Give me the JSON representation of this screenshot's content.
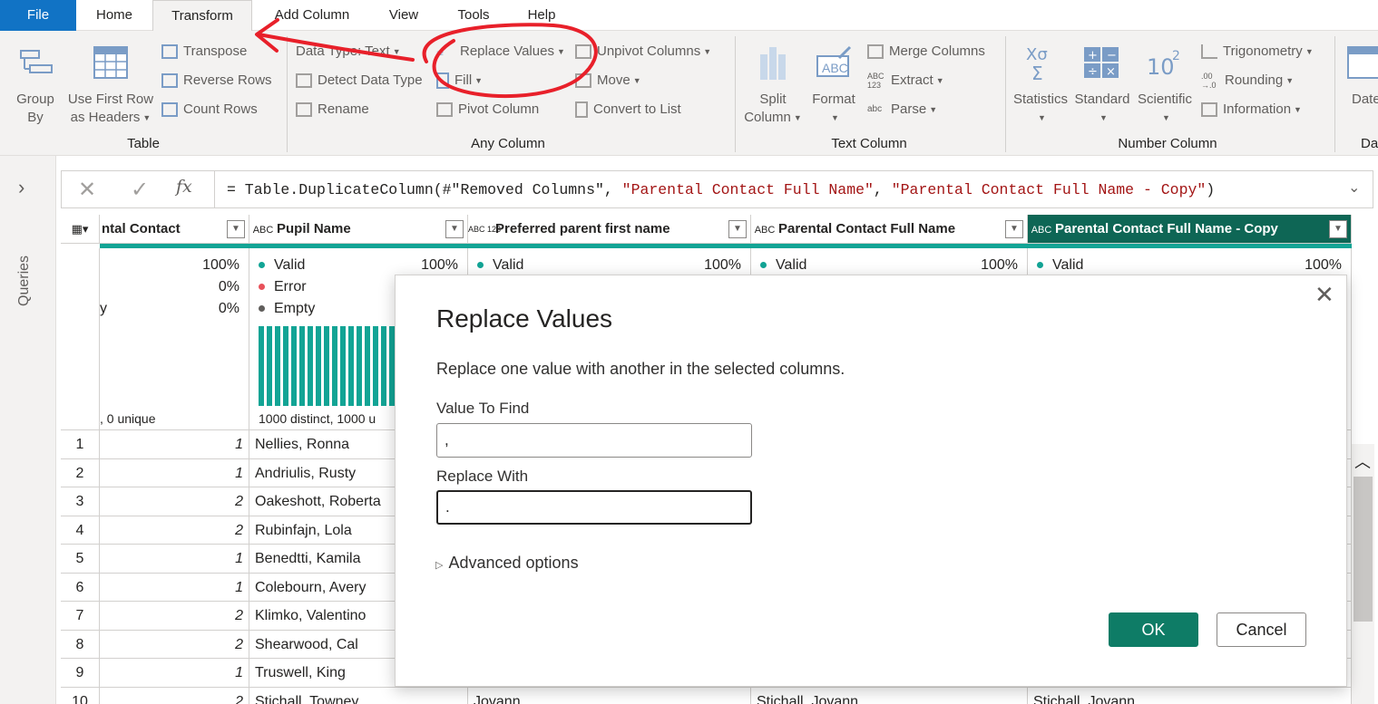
{
  "tabs": [
    "File",
    "Home",
    "Transform",
    "Add Column",
    "View",
    "Tools",
    "Help"
  ],
  "active_tab": "Transform",
  "ribbon": {
    "table": {
      "label": "Table",
      "group_by": [
        "Group",
        "By"
      ],
      "use_first_row": [
        "Use First Row",
        "as Headers"
      ],
      "transpose": "Transpose",
      "reverse_rows": "Reverse Rows",
      "count_rows": "Count Rows"
    },
    "any_column": {
      "label": "Any Column",
      "data_type": "Data Type: Text",
      "detect_data_type": "Detect Data Type",
      "rename": "Rename",
      "replace_values": "Replace Values",
      "fill": "Fill",
      "pivot_column": "Pivot Column",
      "unpivot_columns": "Unpivot Columns",
      "move": "Move",
      "convert_to_list": "Convert to List"
    },
    "text_column": {
      "label": "Text Column",
      "split_column": [
        "Split",
        "Column"
      ],
      "format": "Format",
      "merge_columns": "Merge Columns",
      "extract": "Extract",
      "parse": "Parse"
    },
    "number_column": {
      "label": "Number Column",
      "statistics": "Statistics",
      "standard": "Standard",
      "scientific": "Scientific",
      "trigonometry": "Trigonometry",
      "rounding": "Rounding",
      "information": "Information"
    },
    "date": {
      "label": "Da",
      "date": "Date"
    }
  },
  "queries_label": "Queries",
  "formula": {
    "prefix": "= Table.DuplicateColumn(#\"Removed Columns\", ",
    "arg1": "\"Parental Contact Full Name\"",
    "sep": ", ",
    "arg2": "\"Parental Contact Full Name - Copy\"",
    "suffix": ")"
  },
  "columns": [
    {
      "name": "ntal Contact",
      "type": ""
    },
    {
      "name": "Pupil Name",
      "type": "ABC"
    },
    {
      "name": "Preferred parent first name",
      "type": "ABC 123"
    },
    {
      "name": "Parental Contact Full Name",
      "type": "ABC"
    },
    {
      "name": "Parental Contact Full Name - Copy",
      "type": "ABC"
    }
  ],
  "profile": {
    "col0": {
      "p1": "100%",
      "p2": "0%",
      "p3": "0%",
      "p3label": "y",
      "footer": ", 0 unique"
    },
    "col1": {
      "valid": "Valid",
      "error": "Error",
      "empty": "Empty",
      "valid_pct": "100%",
      "footer": "1000 distinct, 1000 u"
    },
    "col2": {
      "valid": "Valid",
      "valid_pct": "100%"
    },
    "col3": {
      "valid": "Valid",
      "valid_pct": "100%"
    },
    "col4": {
      "valid": "Valid",
      "valid_pct": "100%"
    }
  },
  "rows": [
    {
      "n": "1",
      "contact": "1",
      "pupil": "Nellies, Ronna"
    },
    {
      "n": "2",
      "contact": "1",
      "pupil": "Andriulis, Rusty"
    },
    {
      "n": "3",
      "contact": "2",
      "pupil": "Oakeshott, Roberta"
    },
    {
      "n": "4",
      "contact": "2",
      "pupil": "Rubinfajn, Lola"
    },
    {
      "n": "5",
      "contact": "1",
      "pupil": "Benedtti, Kamila"
    },
    {
      "n": "6",
      "contact": "1",
      "pupil": "Colebourn, Avery"
    },
    {
      "n": "7",
      "contact": "2",
      "pupil": "Klimko, Valentino"
    },
    {
      "n": "8",
      "contact": "2",
      "pupil": "Shearwood, Cal"
    },
    {
      "n": "9",
      "contact": "1",
      "pupil": "Truswell, King"
    },
    {
      "n": "10",
      "contact": "2",
      "pupil": "Stichall, Towney",
      "pref": "Jovann",
      "full": "Stichall, Jovann",
      "copy": "Stichall, Jovann"
    }
  ],
  "dialog": {
    "title": "Replace Values",
    "description": "Replace one value with another in the selected columns.",
    "find_label": "Value To Find",
    "find_value": ",",
    "replace_label": "Replace With",
    "replace_value": ".",
    "advanced": "Advanced options",
    "ok": "OK",
    "cancel": "Cancel"
  },
  "colors": {
    "accent": "#0e7c66",
    "file_tab": "#1173c5",
    "annotation": "#e8202a",
    "quality": "#12a495"
  }
}
